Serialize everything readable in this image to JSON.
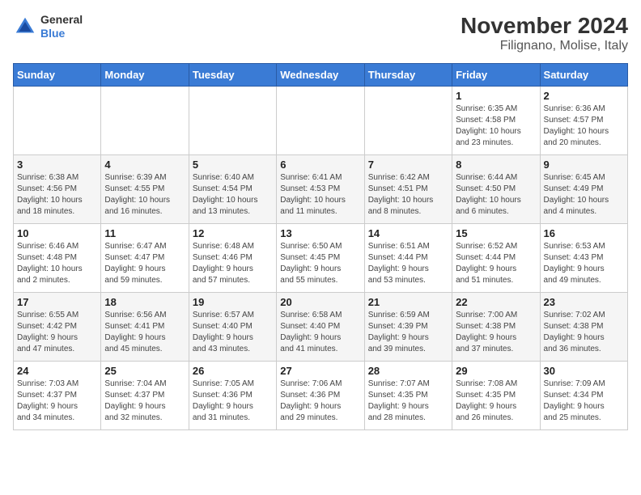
{
  "header": {
    "logo_general": "General",
    "logo_blue": "Blue",
    "title": "November 2024",
    "subtitle": "Filignano, Molise, Italy"
  },
  "days_of_week": [
    "Sunday",
    "Monday",
    "Tuesday",
    "Wednesday",
    "Thursday",
    "Friday",
    "Saturday"
  ],
  "weeks": [
    [
      {
        "day": "",
        "info": ""
      },
      {
        "day": "",
        "info": ""
      },
      {
        "day": "",
        "info": ""
      },
      {
        "day": "",
        "info": ""
      },
      {
        "day": "",
        "info": ""
      },
      {
        "day": "1",
        "info": "Sunrise: 6:35 AM\nSunset: 4:58 PM\nDaylight: 10 hours\nand 23 minutes."
      },
      {
        "day": "2",
        "info": "Sunrise: 6:36 AM\nSunset: 4:57 PM\nDaylight: 10 hours\nand 20 minutes."
      }
    ],
    [
      {
        "day": "3",
        "info": "Sunrise: 6:38 AM\nSunset: 4:56 PM\nDaylight: 10 hours\nand 18 minutes."
      },
      {
        "day": "4",
        "info": "Sunrise: 6:39 AM\nSunset: 4:55 PM\nDaylight: 10 hours\nand 16 minutes."
      },
      {
        "day": "5",
        "info": "Sunrise: 6:40 AM\nSunset: 4:54 PM\nDaylight: 10 hours\nand 13 minutes."
      },
      {
        "day": "6",
        "info": "Sunrise: 6:41 AM\nSunset: 4:53 PM\nDaylight: 10 hours\nand 11 minutes."
      },
      {
        "day": "7",
        "info": "Sunrise: 6:42 AM\nSunset: 4:51 PM\nDaylight: 10 hours\nand 8 minutes."
      },
      {
        "day": "8",
        "info": "Sunrise: 6:44 AM\nSunset: 4:50 PM\nDaylight: 10 hours\nand 6 minutes."
      },
      {
        "day": "9",
        "info": "Sunrise: 6:45 AM\nSunset: 4:49 PM\nDaylight: 10 hours\nand 4 minutes."
      }
    ],
    [
      {
        "day": "10",
        "info": "Sunrise: 6:46 AM\nSunset: 4:48 PM\nDaylight: 10 hours\nand 2 minutes."
      },
      {
        "day": "11",
        "info": "Sunrise: 6:47 AM\nSunset: 4:47 PM\nDaylight: 9 hours\nand 59 minutes."
      },
      {
        "day": "12",
        "info": "Sunrise: 6:48 AM\nSunset: 4:46 PM\nDaylight: 9 hours\nand 57 minutes."
      },
      {
        "day": "13",
        "info": "Sunrise: 6:50 AM\nSunset: 4:45 PM\nDaylight: 9 hours\nand 55 minutes."
      },
      {
        "day": "14",
        "info": "Sunrise: 6:51 AM\nSunset: 4:44 PM\nDaylight: 9 hours\nand 53 minutes."
      },
      {
        "day": "15",
        "info": "Sunrise: 6:52 AM\nSunset: 4:44 PM\nDaylight: 9 hours\nand 51 minutes."
      },
      {
        "day": "16",
        "info": "Sunrise: 6:53 AM\nSunset: 4:43 PM\nDaylight: 9 hours\nand 49 minutes."
      }
    ],
    [
      {
        "day": "17",
        "info": "Sunrise: 6:55 AM\nSunset: 4:42 PM\nDaylight: 9 hours\nand 47 minutes."
      },
      {
        "day": "18",
        "info": "Sunrise: 6:56 AM\nSunset: 4:41 PM\nDaylight: 9 hours\nand 45 minutes."
      },
      {
        "day": "19",
        "info": "Sunrise: 6:57 AM\nSunset: 4:40 PM\nDaylight: 9 hours\nand 43 minutes."
      },
      {
        "day": "20",
        "info": "Sunrise: 6:58 AM\nSunset: 4:40 PM\nDaylight: 9 hours\nand 41 minutes."
      },
      {
        "day": "21",
        "info": "Sunrise: 6:59 AM\nSunset: 4:39 PM\nDaylight: 9 hours\nand 39 minutes."
      },
      {
        "day": "22",
        "info": "Sunrise: 7:00 AM\nSunset: 4:38 PM\nDaylight: 9 hours\nand 37 minutes."
      },
      {
        "day": "23",
        "info": "Sunrise: 7:02 AM\nSunset: 4:38 PM\nDaylight: 9 hours\nand 36 minutes."
      }
    ],
    [
      {
        "day": "24",
        "info": "Sunrise: 7:03 AM\nSunset: 4:37 PM\nDaylight: 9 hours\nand 34 minutes."
      },
      {
        "day": "25",
        "info": "Sunrise: 7:04 AM\nSunset: 4:37 PM\nDaylight: 9 hours\nand 32 minutes."
      },
      {
        "day": "26",
        "info": "Sunrise: 7:05 AM\nSunset: 4:36 PM\nDaylight: 9 hours\nand 31 minutes."
      },
      {
        "day": "27",
        "info": "Sunrise: 7:06 AM\nSunset: 4:36 PM\nDaylight: 9 hours\nand 29 minutes."
      },
      {
        "day": "28",
        "info": "Sunrise: 7:07 AM\nSunset: 4:35 PM\nDaylight: 9 hours\nand 28 minutes."
      },
      {
        "day": "29",
        "info": "Sunrise: 7:08 AM\nSunset: 4:35 PM\nDaylight: 9 hours\nand 26 minutes."
      },
      {
        "day": "30",
        "info": "Sunrise: 7:09 AM\nSunset: 4:34 PM\nDaylight: 9 hours\nand 25 minutes."
      }
    ]
  ]
}
